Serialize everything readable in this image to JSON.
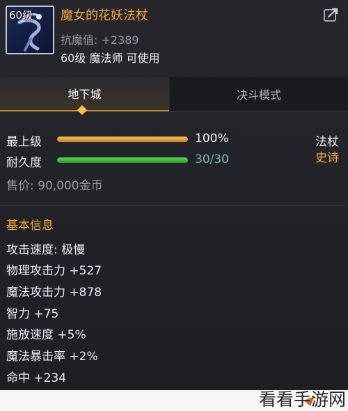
{
  "item": {
    "level_badge": "60级",
    "name": "魔女的花妖法杖",
    "resist": "抗魔值: +2389",
    "usable": "60级 魔法师 可使用",
    "icon": "staff-icon",
    "share_icon": "share-icon"
  },
  "tabs": [
    {
      "label": "地下城",
      "active": true
    },
    {
      "label": "决斗模式",
      "active": false
    }
  ],
  "stats": {
    "grade_label": "最上级",
    "grade_value": "100%",
    "grade_fraction": 1.0,
    "durability_label": "耐久度",
    "durability_value": "30/30",
    "durability_fraction": 1.0,
    "type_tag": "法杖",
    "rarity_tag": "史诗",
    "price": "售价: 90,000金币"
  },
  "basic_info": {
    "title": "基本信息",
    "attributes": [
      "攻击速度: 极慢",
      "物理攻击力 +527",
      "魔法攻击力 +878",
      "智力 +75",
      "施放速度 +5%",
      "魔法暴击率 +2%",
      "命中 +234"
    ]
  },
  "watermark": "看看手游网",
  "colors": {
    "accent_gold": "#f2a93b",
    "bar_green": "#3fbf3c",
    "value_teal": "#7fb7bd",
    "background": "#1c1d22"
  }
}
